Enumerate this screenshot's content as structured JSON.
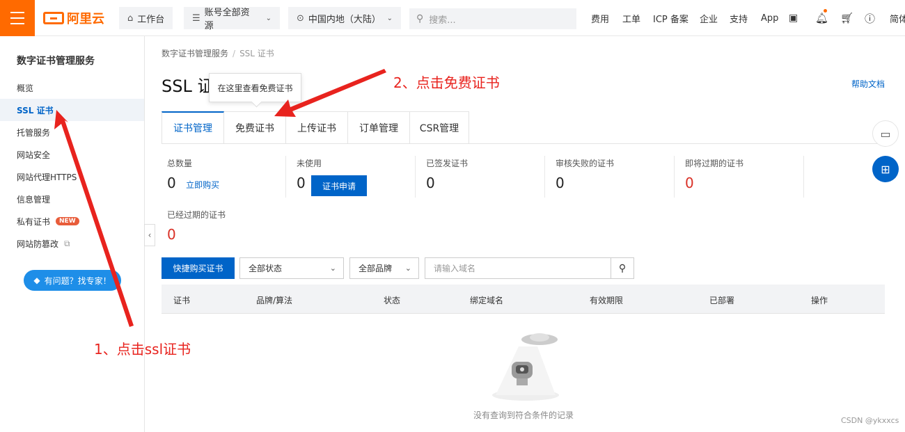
{
  "topbar": {
    "logo_text": "阿里云",
    "workbench_label": "工作台",
    "resources_label": "账号全部资源",
    "region_label": "中国内地（大陆）",
    "search_placeholder": "搜索...",
    "nav": [
      "费用",
      "工单",
      "ICP 备案",
      "企业",
      "支持",
      "App"
    ],
    "lang": "简体",
    "accent_color": "#ff6a00"
  },
  "sidebar": {
    "title": "数字证书管理服务",
    "items": [
      {
        "label": "概览"
      },
      {
        "label": "SSL 证书"
      },
      {
        "label": "托管服务"
      },
      {
        "label": "网站安全"
      },
      {
        "label": "网站代理HTTPS"
      },
      {
        "label": "信息管理"
      },
      {
        "label": "私有证书",
        "badge": "NEW"
      },
      {
        "label": "网站防篡改"
      }
    ],
    "help_button": "有问题？找专家！"
  },
  "main": {
    "breadcrumb": [
      "数字证书管理服务",
      "SSL 证书"
    ],
    "title": "SSL 证",
    "tooltip": "在这里查看免费证书",
    "help_doc": "帮助文档",
    "tabs": [
      "证书管理",
      "免费证书",
      "上传证书",
      "订单管理",
      "CSR管理"
    ],
    "stats": {
      "total_label": "总数量",
      "total_value": "0",
      "buy_link": "立即购买",
      "unused_label": "未使用",
      "unused_value": "0",
      "apply_button": "证书申请",
      "issued_label": "已签发证书",
      "issued_value": "0",
      "failed_label": "审核失败的证书",
      "failed_value": "0",
      "expiring_label": "即将过期的证书",
      "expiring_value": "0",
      "expired_label": "已经过期的证书",
      "expired_value": "0"
    },
    "toolbar": {
      "buy_button": "快捷购买证书",
      "status_select": "全部状态",
      "brand_select": "全部品牌",
      "domain_placeholder": "请输入域名"
    },
    "table_headers": [
      "证书",
      "品牌/算法",
      "状态",
      "绑定域名",
      "有效期限",
      "已部署",
      "操作"
    ],
    "empty_text": "没有查询到符合条件的记录"
  },
  "annotations": {
    "step1": "1、点击ssl证书",
    "step2": "2、点击免费证书",
    "color": "#e8231e"
  },
  "watermark": "CSDN @ykxxcs"
}
